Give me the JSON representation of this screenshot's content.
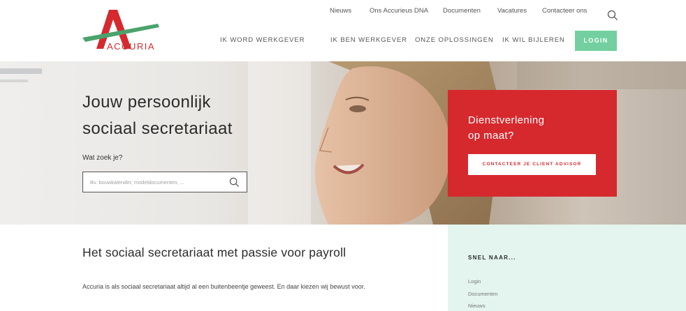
{
  "brand": {
    "name": "ACCURIA",
    "accent": "#d6292e",
    "green": "#73cf9f"
  },
  "top_nav": [
    {
      "label": "Nieuws"
    },
    {
      "label": "Ons Accurieus DNA"
    },
    {
      "label": "Documenten"
    },
    {
      "label": "Vacatures"
    },
    {
      "label": "Contacteer ons"
    }
  ],
  "search_icon": "search-icon",
  "main_nav": [
    {
      "label": "IK WORD WERKGEVER"
    },
    {
      "label": "IK BEN WERKGEVER"
    },
    {
      "label": "ONZE OPLOSSINGEN"
    },
    {
      "label": "IK WIL BIJLEREN"
    }
  ],
  "login_label": "LOGIN",
  "hero": {
    "title_line1": "Jouw persoonlijk",
    "title_line2": "sociaal secretariaat",
    "search_label": "Wat zoek je?",
    "search_placeholder": "Bv. bouwkalender, modeldocumenten, ...",
    "cta_line1": "Dienstverlening",
    "cta_line2": "op maat?",
    "cta_button": "CONTACTEER JE CLIENT ADVISOR"
  },
  "content": {
    "title": "Het sociaal secretariaat met passie voor payroll",
    "text": "Accuria is als sociaal secretariaat altijd al een buitenbeentje geweest. En daar kiezen wij bewust voor."
  },
  "aside": {
    "title": "SNEL NAAR...",
    "links": [
      "Login",
      "Documenten",
      "Nieuws"
    ]
  }
}
